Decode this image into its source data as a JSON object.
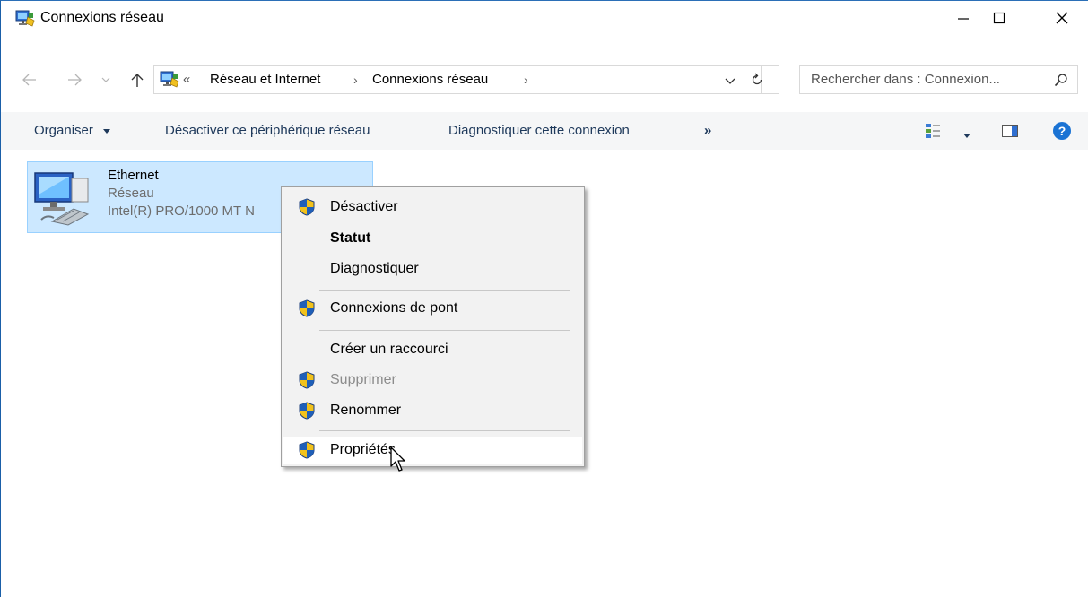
{
  "window": {
    "title": "Connexions réseau",
    "icon": "network-connections-icon",
    "controls": [
      "minimize-icon",
      "maximize-icon",
      "close-icon"
    ]
  },
  "address": {
    "lead": "«",
    "breadcrumbs": [
      "Réseau et Internet",
      "Connexions réseau"
    ],
    "separator": "›",
    "search_placeholder": "Rechercher dans : Connexion..."
  },
  "commands": {
    "organize": "Organiser",
    "disable_device": "Désactiver ce périphérique réseau",
    "diagnose": "Diagnostiquer cette connexion",
    "more": "»"
  },
  "items": [
    {
      "name": "Ethernet",
      "network": "Réseau",
      "adapter": "Intel(R) PRO/1000 MT N",
      "selected": true
    }
  ],
  "context_menu": {
    "items": [
      {
        "label": "Désactiver",
        "shield": true,
        "bold": false,
        "disabled": false
      },
      {
        "label": "Statut",
        "shield": false,
        "bold": true,
        "disabled": false
      },
      {
        "label": "Diagnostiquer",
        "shield": false,
        "bold": false,
        "disabled": false
      },
      {
        "label": "Connexions de pont",
        "shield": true,
        "bold": false,
        "disabled": false
      },
      {
        "label": "Créer un raccourci",
        "shield": false,
        "bold": false,
        "disabled": false
      },
      {
        "label": "Supprimer",
        "shield": true,
        "bold": false,
        "disabled": true
      },
      {
        "label": "Renommer",
        "shield": true,
        "bold": false,
        "disabled": false
      },
      {
        "label": "Propriétés",
        "shield": true,
        "bold": false,
        "disabled": false,
        "hovered": true
      }
    ]
  },
  "colors": {
    "selection": "#cce8ff",
    "command_text": "#1e395b",
    "help_blue": "#1a73d4",
    "shield_blue": "#1f5fb8",
    "shield_yellow": "#f2c21b"
  }
}
